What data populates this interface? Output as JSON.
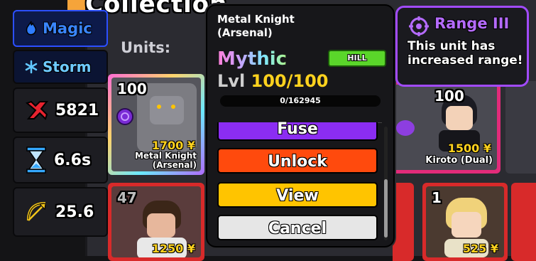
{
  "collection": {
    "title": "Collection",
    "units_label": "Units:"
  },
  "sidebar": {
    "element_tag": "Magic",
    "trait": "Storm",
    "stats": [
      {
        "icon": "damage-icon",
        "value": "5821",
        "color": "#e8232f"
      },
      {
        "icon": "hourglass-icon",
        "value": "6.6s",
        "color": "#35a8ff"
      },
      {
        "icon": "range-bow-icon",
        "value": "25.6",
        "color": "#f2c41a"
      }
    ]
  },
  "cards": [
    {
      "level": "100",
      "price": "1700 ¥",
      "name": "Metal Knight (Arsenal)",
      "selected": true
    },
    {
      "level": "100",
      "price": "1500 ¥",
      "name": "Kiroto (Dual)",
      "selected": false
    },
    {
      "level": "47",
      "price": "1250 ¥",
      "name": "",
      "selected": false
    },
    {
      "level": "1",
      "price": "525 ¥",
      "name": "",
      "selected": false
    }
  ],
  "popup": {
    "name": "Metal Knight (Arsenal)",
    "rarity": "Mythic",
    "badge": "HILL",
    "level_prefix": "Lvl",
    "level_value": "100/100",
    "xp_text": "0/162945",
    "xp_progress": 0.0,
    "buttons": {
      "fuse": "Fuse",
      "unlock": "Unlock",
      "view": "View",
      "cancel": "Cancel"
    }
  },
  "tooltip": {
    "title": "Range III",
    "description": "This unit has increased range!",
    "accent": "#a24bff"
  },
  "colors": {
    "rarity_gradient": [
      "#ff7fd8",
      "#c7a3ff",
      "#7ee7ff",
      "#aef58a"
    ],
    "yen_gold": "#ffd21e",
    "fuse": "#8b2df2",
    "unlock": "#ff4a0d",
    "view": "#ffc400",
    "cancel": "#e6e6e6"
  }
}
